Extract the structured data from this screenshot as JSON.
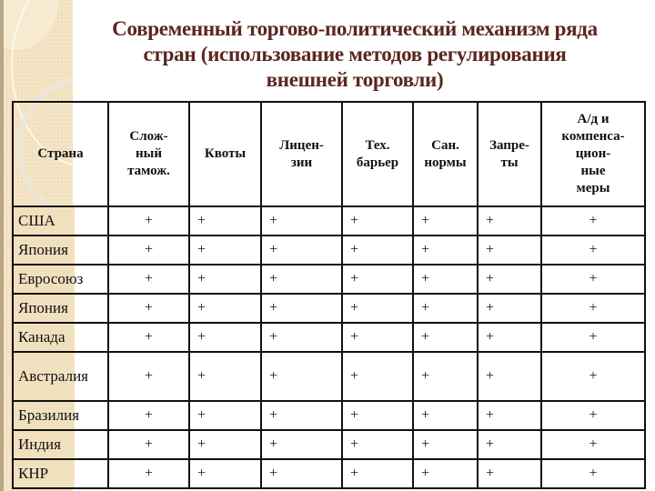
{
  "slide": {
    "title_lines": [
      "Современный торгово-политический механизм ряда",
      "стран (использование методов регулирования",
      "внешней торговли)"
    ]
  },
  "table": {
    "headers": [
      "Страна",
      "Слож-\nный\nтамож.",
      "Квоты",
      "Лицен-\nзии",
      "Тех.\nбарьер",
      "Сан.\nнормы",
      "Запре-\nты",
      "А/д и\nкомпенса-\nцион-\nные\nмеры"
    ],
    "rows": [
      {
        "country": "США",
        "marks": [
          "+",
          "+",
          "+",
          "+",
          "+",
          "+",
          "+"
        ]
      },
      {
        "country": "Япония",
        "marks": [
          "+",
          "+",
          "+",
          "+",
          "+",
          "+",
          "+"
        ]
      },
      {
        "country": "Евросоюз",
        "marks": [
          "+",
          "+",
          "+",
          "+",
          "+",
          "+",
          "+"
        ]
      },
      {
        "country": "Япония",
        "marks": [
          "+",
          "+",
          "+",
          "+",
          "+",
          "+",
          "+"
        ]
      },
      {
        "country": "Канада",
        "marks": [
          "+",
          "+",
          "+",
          "+",
          "+",
          "+",
          "+"
        ]
      },
      {
        "country": "Австралия",
        "marks": [
          "+",
          "+",
          "+",
          "+",
          "+",
          "+",
          "+"
        ]
      },
      {
        "country": "Бразилия",
        "marks": [
          "+",
          "+",
          "+",
          "+",
          "+",
          "+",
          "+"
        ]
      },
      {
        "country": "Индия",
        "marks": [
          "+",
          "+",
          "+",
          "+",
          "+",
          "+",
          "+"
        ]
      },
      {
        "country": "КНР",
        "marks": [
          "+",
          "+",
          "+",
          "+",
          "+",
          "+",
          "+"
        ]
      }
    ]
  },
  "colors": {
    "title": "#5b2620",
    "side_band": "#f1e0bd",
    "grid_lines": "#111111"
  }
}
